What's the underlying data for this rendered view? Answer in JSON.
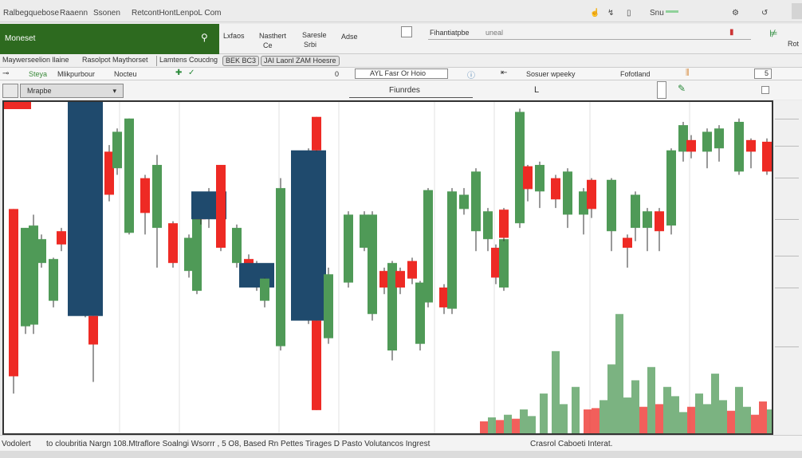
{
  "titlebar": {
    "items": [
      "Ralbegquebose",
      "Raaenn",
      "Ssonen",
      "RetcontHontLenpoL Com"
    ],
    "right_icons": [
      "hand-icon",
      "chart-icon",
      "lock-icon",
      "line-icon",
      "settings-icon"
    ],
    "right_label": "Snu"
  },
  "header": {
    "title": "Moneset",
    "search_icon": "search-icon"
  },
  "ribbon": {
    "groups": [
      "Lxfaos",
      "Nasthert",
      "Saresle",
      "Adse"
    ],
    "sublabels": [
      "Ce",
      "Srbi"
    ],
    "field_value": "Fihantiatpbe",
    "field_suffix": "uneal",
    "right_label": "Rot"
  },
  "tabs": [
    "Maywerseelion llaine",
    "Rasolpot",
    "Maythorset",
    "Lamtens Coucdng",
    "BEK BC3",
    "JAI Laonl ZAM Hoesre"
  ],
  "toolbar": {
    "items": [
      "Steya",
      "Mlikpurbour",
      "Nocteu"
    ],
    "counter": "0",
    "field": "AYL Fasr Or Hoio",
    "labels": [
      "Sosuer wpeeky",
      "Fofotland"
    ],
    "page": "5"
  },
  "row3": {
    "dropdown": "Mrapbe",
    "dropdown2": "Fiunrdes",
    "center_label": "L"
  },
  "status": {
    "left": "Vodolert",
    "main": "to cloubritia Nargn 108.Mtraflore Soalngi Wsorrr , 5 O8, Based Rn Pettes Tirages D Pasto Volutancos Ingrest",
    "right": "Crasrol Caboeti Interat."
  },
  "colors": {
    "up": "#4f9a57",
    "down": "#ee2a24",
    "blue": "#1f4a6d",
    "header": "#2d6a1f"
  },
  "chart_data": {
    "type": "candlestick",
    "xlabel": "",
    "ylabel": "",
    "ylim": [
      0,
      100
    ],
    "grid": true,
    "candles_fields": [
      "slot",
      "top",
      "bottom",
      "high",
      "low",
      "color"
    ],
    "candles": [
      [
        2,
        67.7,
        17.2,
        67.7,
        12,
        "r"
      ],
      [
        5,
        62,
        32.3,
        62,
        30,
        "g"
      ],
      [
        7,
        62.7,
        32.8,
        66,
        30,
        "g"
      ],
      [
        9,
        58.6,
        51.4,
        60,
        50,
        "g"
      ],
      [
        12,
        52.6,
        40,
        53,
        38,
        "g"
      ],
      [
        14,
        61,
        57,
        62,
        55,
        "r"
      ],
      [
        20,
        100,
        35.4,
        100,
        35,
        "b"
      ],
      [
        22,
        35.4,
        26.8,
        35.4,
        15.5,
        "r"
      ],
      [
        26,
        85,
        72,
        87,
        70,
        "r"
      ],
      [
        28,
        91,
        80,
        92,
        78,
        "g"
      ],
      [
        31,
        95,
        60.5,
        95,
        60,
        "g"
      ],
      [
        35,
        77,
        66.5,
        78,
        60,
        "r"
      ],
      [
        38,
        81,
        62,
        84,
        50,
        "g"
      ],
      [
        42,
        63.4,
        51.4,
        64,
        50,
        "r"
      ],
      [
        46,
        59,
        49,
        60,
        47,
        "g"
      ],
      [
        48,
        70.6,
        43,
        72,
        42,
        "g"
      ],
      [
        49,
        70.6,
        64.6,
        71,
        63,
        "r"
      ],
      [
        51,
        73,
        64.6,
        74,
        62,
        "b"
      ],
      [
        54,
        81,
        56,
        81,
        55,
        "r"
      ],
      [
        58,
        62,
        51.4,
        63,
        50,
        "g"
      ],
      [
        61,
        52.6,
        46.7,
        54,
        45,
        "r"
      ],
      [
        63,
        51.4,
        44,
        52,
        43,
        "b"
      ],
      [
        65,
        46.7,
        40,
        47,
        38,
        "g"
      ],
      [
        69,
        74,
        26.3,
        77,
        25,
        "g"
      ],
      [
        76,
        85.4,
        34,
        86,
        33,
        "b"
      ],
      [
        78,
        95.5,
        85.4,
        95.5,
        85,
        "r"
      ],
      [
        78,
        34,
        7,
        34,
        7,
        "r"
      ],
      [
        81,
        48,
        28.7,
        50,
        27,
        "g"
      ],
      [
        86,
        66,
        45.5,
        67,
        44,
        "g"
      ],
      [
        90,
        66,
        56,
        67,
        55,
        "g"
      ],
      [
        92,
        66,
        36,
        67,
        34,
        "g"
      ],
      [
        95,
        49,
        44,
        50,
        42,
        "r"
      ],
      [
        97,
        51.4,
        25,
        52,
        22,
        "g"
      ],
      [
        99,
        49,
        44,
        50,
        42,
        "r"
      ],
      [
        102,
        52,
        46.7,
        53,
        45,
        "r"
      ],
      [
        104,
        45.5,
        27,
        46,
        25,
        "g"
      ],
      [
        106,
        73.4,
        39.5,
        74,
        38,
        "g"
      ],
      [
        110,
        44,
        38,
        45,
        36,
        "r"
      ],
      [
        112,
        73,
        37.6,
        74,
        36,
        "g"
      ],
      [
        115,
        72,
        67.7,
        74,
        66,
        "g"
      ],
      [
        118,
        79,
        61,
        80,
        55,
        "g"
      ],
      [
        121,
        67,
        58.6,
        68,
        55,
        "g"
      ],
      [
        123,
        56,
        47,
        57,
        45,
        "r"
      ],
      [
        125,
        58.6,
        44,
        59,
        43,
        "g"
      ],
      [
        125,
        67.5,
        59,
        68,
        58,
        "r"
      ],
      [
        129,
        97,
        63.4,
        98,
        62,
        "g"
      ],
      [
        131,
        80.6,
        73.7,
        81,
        70,
        "r"
      ],
      [
        134,
        81,
        73,
        82,
        68,
        "g"
      ],
      [
        138,
        77,
        70.6,
        78,
        68,
        "r"
      ],
      [
        141,
        79,
        66,
        80,
        62,
        "g"
      ],
      [
        145,
        73,
        66,
        74,
        60,
        "g"
      ],
      [
        147,
        76.5,
        67.7,
        77,
        65,
        "r"
      ],
      [
        152,
        76.5,
        61,
        77,
        55,
        "g"
      ],
      [
        156,
        59,
        56,
        60,
        50,
        "r"
      ],
      [
        158,
        72,
        62,
        73,
        58,
        "g"
      ],
      [
        161,
        67,
        62,
        68,
        55,
        "g"
      ],
      [
        164,
        67,
        61,
        68,
        55,
        "r"
      ],
      [
        167,
        85.4,
        62.7,
        86,
        60,
        "g"
      ],
      [
        170,
        93,
        85,
        94,
        82,
        "g"
      ],
      [
        172,
        88.5,
        85,
        90,
        83,
        "r"
      ],
      [
        176,
        91,
        85,
        92,
        80,
        "g"
      ],
      [
        179,
        92,
        86,
        93,
        82,
        "g"
      ],
      [
        184,
        94,
        79,
        95,
        78,
        "g"
      ],
      [
        187,
        88.5,
        85,
        89,
        80,
        "r"
      ],
      [
        191,
        88,
        79,
        89,
        78,
        "r"
      ]
    ],
    "volume": [
      [
        120,
        9,
        "r"
      ],
      [
        122,
        12,
        "g"
      ],
      [
        124,
        10,
        "r"
      ],
      [
        126,
        14,
        "g"
      ],
      [
        128,
        11,
        "r"
      ],
      [
        130,
        18,
        "g"
      ],
      [
        132,
        13,
        "g"
      ],
      [
        135,
        30,
        "g"
      ],
      [
        138,
        62,
        "g"
      ],
      [
        140,
        22,
        "g"
      ],
      [
        143,
        35,
        "g"
      ],
      [
        146,
        18,
        "r"
      ],
      [
        148,
        19,
        "r"
      ],
      [
        150,
        25,
        "g"
      ],
      [
        152,
        52,
        "g"
      ],
      [
        154,
        90,
        "g"
      ],
      [
        156,
        27,
        "g"
      ],
      [
        158,
        40,
        "g"
      ],
      [
        160,
        20,
        "r"
      ],
      [
        162,
        50,
        "g"
      ],
      [
        164,
        22,
        "r"
      ],
      [
        166,
        35,
        "g"
      ],
      [
        168,
        28,
        "g"
      ],
      [
        170,
        16,
        "g"
      ],
      [
        172,
        20,
        "r"
      ],
      [
        174,
        30,
        "g"
      ],
      [
        176,
        22,
        "g"
      ],
      [
        178,
        45,
        "g"
      ],
      [
        180,
        25,
        "g"
      ],
      [
        182,
        17,
        "r"
      ],
      [
        184,
        35,
        "g"
      ],
      [
        186,
        20,
        "g"
      ],
      [
        188,
        14,
        "r"
      ],
      [
        190,
        24,
        "r"
      ],
      [
        192,
        18,
        "g"
      ]
    ]
  }
}
